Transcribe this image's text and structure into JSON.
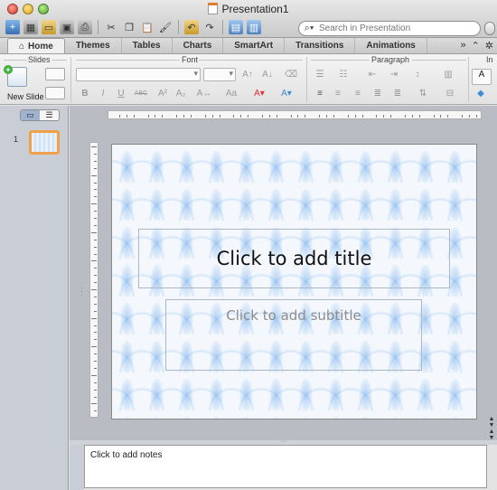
{
  "window": {
    "title": "Presentation1"
  },
  "search": {
    "placeholder": "Search in Presentation"
  },
  "tabs": [
    {
      "label": "Home",
      "active": true
    },
    {
      "label": "Themes"
    },
    {
      "label": "Tables"
    },
    {
      "label": "Charts"
    },
    {
      "label": "SmartArt"
    },
    {
      "label": "Transitions"
    },
    {
      "label": "Animations"
    }
  ],
  "ribbon": {
    "groups": {
      "slides": "Slides",
      "font": "Font",
      "paragraph": "Paragraph",
      "insert": "In"
    },
    "new_slide_label": "New Slide"
  },
  "thumbnails": [
    {
      "number": "1"
    }
  ],
  "slide": {
    "title_placeholder": "Click to add title",
    "subtitle_placeholder": "Click to add subtitle"
  },
  "notes": {
    "placeholder": "Click to add notes"
  },
  "colors": {
    "thumb_highlight": "#f0a046",
    "active_tab_bg": "#f0f0f0"
  },
  "icons": [
    "close-icon",
    "minimize-icon",
    "zoom-icon",
    "new-icon",
    "templates-icon",
    "open-icon",
    "save-icon",
    "print-icon",
    "cut-icon",
    "copy-icon",
    "paste-icon",
    "format-painter-icon",
    "undo-icon",
    "redo-icon",
    "media-icon",
    "search-icon",
    "home-icon",
    "help-icon",
    "chevron-up-icon",
    "gear-icon"
  ]
}
